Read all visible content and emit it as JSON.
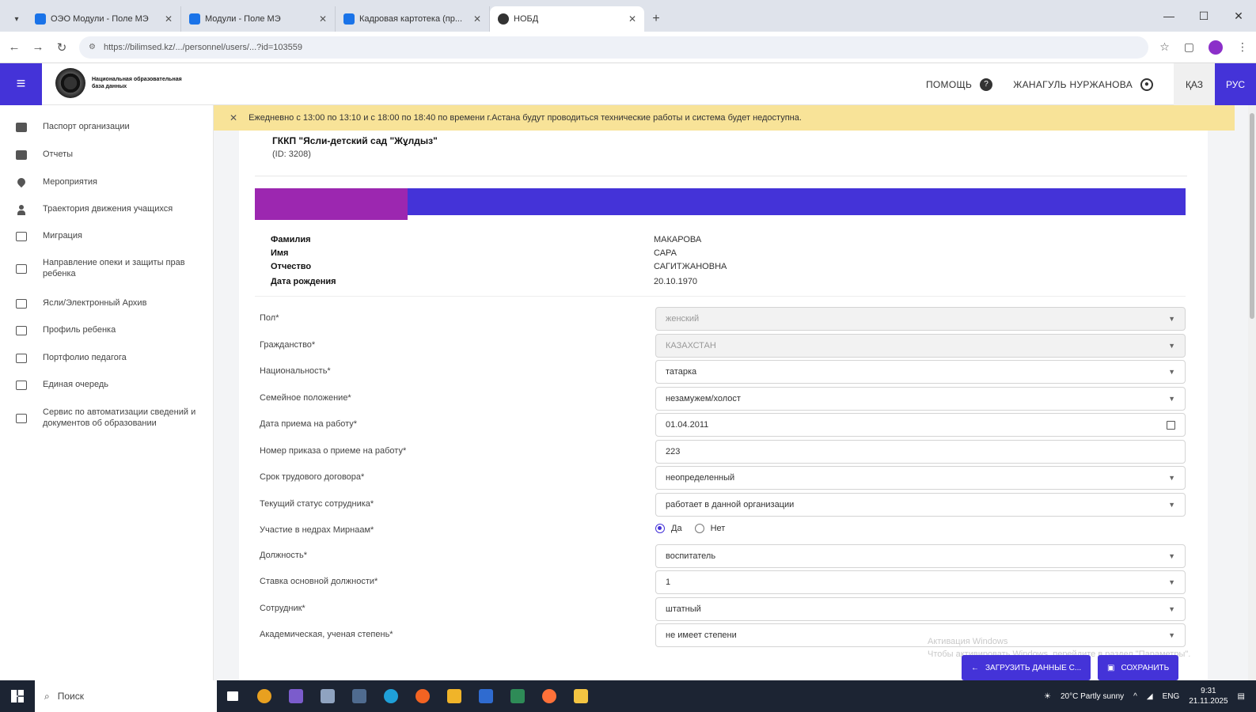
{
  "browser": {
    "tabs": [
      {
        "title": "ОЭО Модули - Поле МЭ",
        "active": false
      },
      {
        "title": "Модули - Поле МЭ",
        "active": false
      },
      {
        "title": "Кадровая картотека (пр...",
        "active": false
      },
      {
        "title": "НОБД",
        "active": true
      }
    ],
    "url": "https://bilimsed.kz/.../personnel/users/...?id=103559",
    "new_tab": "+"
  },
  "header": {
    "logo_text": "Национальная образовательная база данных",
    "help_label": "ПОМОЩЬ",
    "user_name": "ЖАНАГУЛЬ НУРЖАНОВА",
    "lang_kk": "ҚАЗ",
    "lang_ru": "РУС"
  },
  "sidebar": {
    "items": [
      {
        "label": "Паспорт организации",
        "icon": "passport-icon"
      },
      {
        "label": "Отчеты",
        "icon": "report-icon"
      },
      {
        "label": "Мероприятия",
        "icon": "location-icon"
      },
      {
        "label": "Траектория движения учащихся",
        "icon": "person-icon"
      },
      {
        "label": "Миграция",
        "icon": "table-icon"
      },
      {
        "label": "Направление опеки и защиты прав ребенка",
        "icon": "table-icon"
      },
      {
        "label": "Ясли/Электронный Архив",
        "icon": "table-icon"
      },
      {
        "label": "Профиль ребенка",
        "icon": "table-icon"
      },
      {
        "label": "Портфолио педагога",
        "icon": "table-icon"
      },
      {
        "label": "Единая очередь",
        "icon": "table-icon"
      },
      {
        "label": "Сервис по автоматизации сведений и документов об образовании",
        "icon": "table-icon"
      }
    ]
  },
  "notice": {
    "text": "Ежедневно с 13:00 по 13:10 и с 18:00 по 18:40 по времени г.Астана будут проводиться технические работы и система будет недоступна."
  },
  "organization": {
    "name": "ГККП \"Ясли-детский сад \"Жұлдыз\"",
    "id": "(ID: 3208)"
  },
  "person": {
    "labels": {
      "surname": "Фамилия",
      "name": "Имя",
      "patronymic": "Отчество",
      "birthdate": "Дата рождения"
    },
    "surname": "МАКАРОВА",
    "name": "САРА",
    "patronymic": "САГИТЖАНОВНА",
    "birthdate": "20.10.1970"
  },
  "form": {
    "fields": [
      {
        "label": "Пол*",
        "value": "женский",
        "type": "select",
        "disabled": true
      },
      {
        "label": "Гражданство*",
        "value": "КАЗАХСТАН",
        "type": "select",
        "disabled": true
      },
      {
        "label": "Национальность*",
        "value": "татарка",
        "type": "select",
        "disabled": false
      },
      {
        "label": "Семейное положение*",
        "value": "незамужем/холост",
        "type": "select",
        "disabled": false
      },
      {
        "label": "Дата приема на работу*",
        "value": "01.04.2011",
        "type": "date",
        "disabled": false
      },
      {
        "label": "Номер приказа о приеме на работу*",
        "value": "223",
        "type": "text",
        "disabled": false
      },
      {
        "label": "Срок трудового договора*",
        "value": "неопределенный",
        "type": "select",
        "disabled": false
      },
      {
        "label": "Текущий статус сотрудника*",
        "value": "работает в данной организации",
        "type": "select",
        "disabled": false
      },
      {
        "label": "Участие в недрах Мирнаам*",
        "type": "radio",
        "options": [
          "Да",
          "Нет"
        ],
        "selected": "Да"
      },
      {
        "label": "Должность*",
        "value": "воспитатель",
        "type": "select",
        "disabled": false
      },
      {
        "label": "Ставка основной должности*",
        "value": "1",
        "type": "select",
        "disabled": false
      },
      {
        "label": "Сотрудник*",
        "value": "штатный",
        "type": "select",
        "disabled": false
      },
      {
        "label": "Академическая, ученая степень*",
        "value": "не имеет степени",
        "type": "select",
        "disabled": false
      }
    ]
  },
  "actions": {
    "upload_label": "ЗАГРУЗИТЬ ДАННЫЕ С...",
    "save_label": "СОХРАНИТЬ"
  },
  "watermark": {
    "line1": "Активация Windows",
    "line2": "Чтобы активировать Windows, перейдите в раздел \"Параметры\"."
  },
  "taskbar": {
    "search_placeholder": "Поиск",
    "weather": "20°C Partly sunny",
    "lang": "ENG",
    "time": "9:31",
    "date": "21.11.2025"
  },
  "colors": {
    "brand": "#4433d8",
    "banner_segment": "#9c27b0",
    "notice": "#f8e398"
  }
}
